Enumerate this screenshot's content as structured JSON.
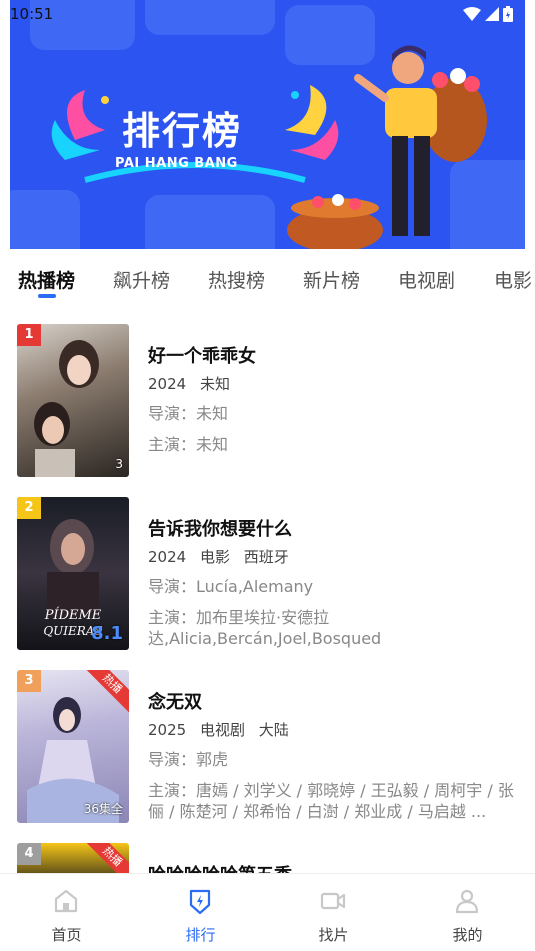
{
  "status_bar": {
    "time": "10:51"
  },
  "banner": {
    "title": "排行榜",
    "subtitle": "PAI HANG BANG"
  },
  "tabs": [
    {
      "label": "热播榜",
      "active": true
    },
    {
      "label": "飙升榜"
    },
    {
      "label": "热搜榜"
    },
    {
      "label": "新片榜"
    },
    {
      "label": "电视剧"
    },
    {
      "label": "电影"
    }
  ],
  "items": [
    {
      "rank": "1",
      "title": "好一个乖乖女",
      "year": "2024",
      "type": "未知",
      "region": "",
      "director": "导演：未知",
      "cast": "主演：未知",
      "poster_note": "3",
      "corner": ""
    },
    {
      "rank": "2",
      "title": "告诉我你想要什么",
      "year": "2024",
      "type": "电影",
      "region": "西班牙",
      "director": "导演：Lucía,Alemany",
      "cast": "主演：加布里埃拉·安德拉达,Alicia,Bercán,Joel,Bosqued",
      "poster_note": "8.1",
      "corner": ""
    },
    {
      "rank": "3",
      "title": "念无双",
      "year": "2025",
      "type": "电视剧",
      "region": "大陆",
      "director": "导演：郭虎",
      "cast": "主演：唐嫣 / 刘学义 / 郭晓婷 / 王弘毅 / 周柯宇 / 张俪 / 陈楚河 / 郑希怡 / 白澍 / 郑业成 / 马启越 ...",
      "poster_note": "36集全",
      "corner": "热播"
    },
    {
      "rank": "4",
      "title": "哈哈哈哈哈第五季",
      "year": "",
      "type": "",
      "region": "",
      "director": "",
      "cast": "",
      "poster_note": "",
      "corner": "热播"
    }
  ],
  "bottom_nav": [
    {
      "label": "首页",
      "icon": "home-icon"
    },
    {
      "label": "排行",
      "icon": "ranking-icon",
      "active": true
    },
    {
      "label": "找片",
      "icon": "video-camera-icon"
    },
    {
      "label": "我的",
      "icon": "user-icon"
    }
  ],
  "colors": {
    "accent": "#2b6cf5",
    "banner_bg": "#2b54f0",
    "rank_1": "#e53935",
    "rank_2": "#f5c518",
    "rank_3": "#f0a05a",
    "rank_4": "#9e9e9e",
    "corner_badge": "#e53935"
  }
}
